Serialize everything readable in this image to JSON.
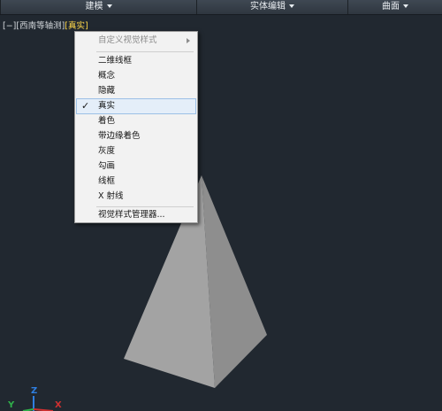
{
  "ribbon": {
    "panels": [
      {
        "label": "建模"
      },
      {
        "label": "实体编辑"
      },
      {
        "label": "曲面"
      }
    ]
  },
  "viewport_controls": {
    "parts": [
      "[−]",
      "[西南等轴测]",
      "[真实]"
    ]
  },
  "context_menu": {
    "custom_visual_styles": "自定义视觉样式",
    "items": [
      {
        "label": "二维线框"
      },
      {
        "label": "概念"
      },
      {
        "label": "隐藏"
      },
      {
        "label": "真实"
      },
      {
        "label": "着色"
      },
      {
        "label": "带边缘着色"
      },
      {
        "label": "灰度"
      },
      {
        "label": "勾画"
      },
      {
        "label": "线框"
      },
      {
        "label": "X 射线"
      }
    ],
    "manager": "视觉样式管理器...",
    "check_mark": "✓"
  },
  "ucs": {
    "z_label": "Z",
    "y_label": "Y",
    "x_label": "X"
  },
  "colors": {
    "viewport_bg": "#212830",
    "active_style_text": "#ffd84a",
    "menu_bg": "#f2f2f2",
    "selection_bg": "#e4eef9",
    "selection_border": "#9cc0e6",
    "pyramid_light": "#a3a3a3",
    "pyramid_dark": "#8e8e8e",
    "axis_x": "#d03030",
    "axis_y": "#2fb04a",
    "axis_z": "#2f7fe0"
  }
}
